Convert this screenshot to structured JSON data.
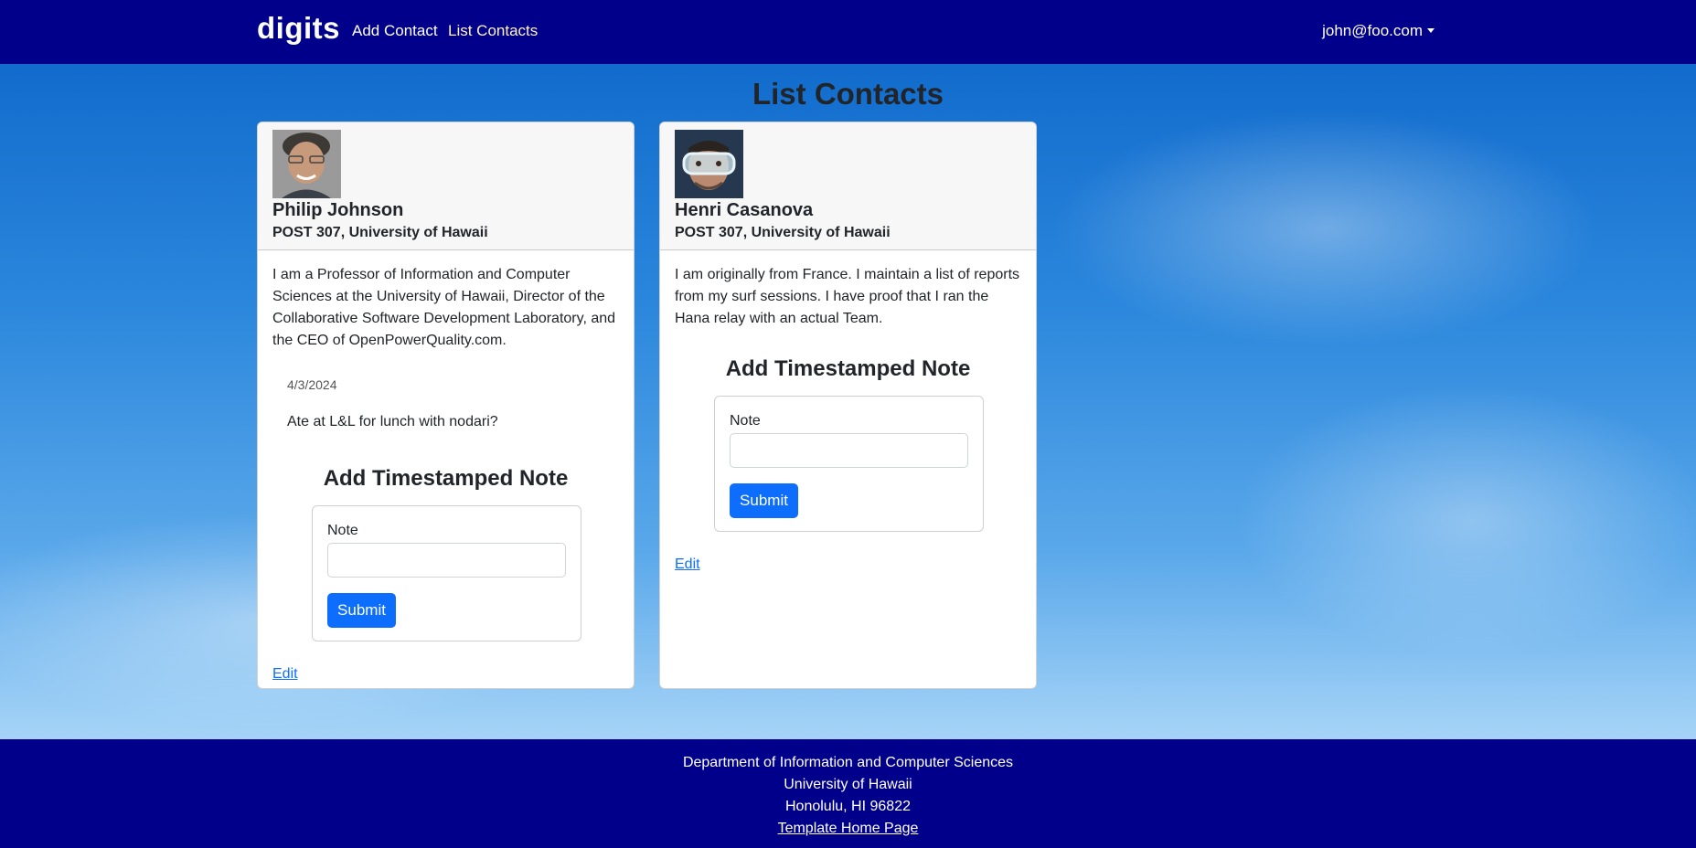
{
  "navbar": {
    "brand": "digits",
    "links": [
      "Add Contact",
      "List Contacts"
    ],
    "user": "john@foo.com",
    "bg_color": "#00008b"
  },
  "page": {
    "title": "List Contacts"
  },
  "contacts": [
    {
      "name": "Philip Johnson",
      "address": "POST 307, University of Hawaii",
      "description": "I am a Professor of Information and Computer Sciences at the University of Hawaii, Director of the Collaborative Software Development Laboratory, and the CEO of OpenPowerQuality.com.",
      "notes": [
        {
          "date": "4/3/2024",
          "text": "Ate at L&L for lunch with nodari?"
        }
      ],
      "form": {
        "title": "Add Timestamped Note",
        "label": "Note",
        "value": "",
        "submit": "Submit"
      },
      "edit": "Edit",
      "avatar": "avatar-photo"
    },
    {
      "name": "Henri Casanova",
      "address": "POST 307, University of Hawaii",
      "description": "I am originally from France. I maintain a list of reports from my surf sessions. I have proof that I ran the Hana relay with an actual Team.",
      "notes": [],
      "form": {
        "title": "Add Timestamped Note",
        "label": "Note",
        "value": "",
        "submit": "Submit"
      },
      "edit": "Edit",
      "avatar": "avatar-photo"
    }
  ],
  "footer": {
    "lines": [
      "Department of Information and Computer Sciences",
      "University of Hawaii",
      "Honolulu, HI 96822"
    ],
    "link": "Template Home Page"
  },
  "colors": {
    "primary": "#0d6efd",
    "navbar": "#00008b",
    "active_link": "#fff3c6"
  }
}
